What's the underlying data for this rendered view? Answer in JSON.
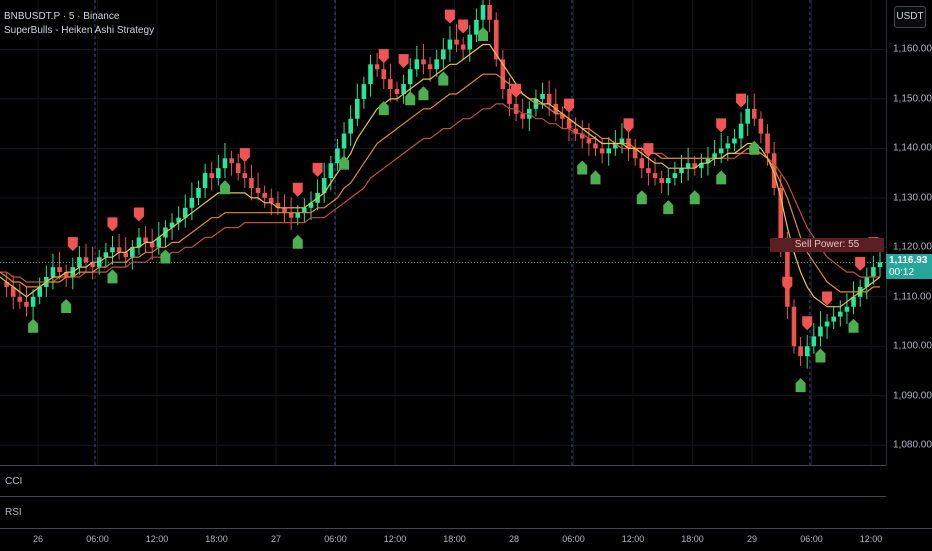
{
  "header": {
    "symbol_line": "BNBUSDT.P · 5 · Binance",
    "strategy_line": "SuperBulls - Heiken Ashi Strategy"
  },
  "currency_button": "USDT",
  "price_axis": {
    "labels": [
      "1,160.00",
      "1,150.00",
      "1,140.00",
      "1,130.00",
      "1,120.00",
      "1,110.00",
      "1,100.00",
      "1,090.00",
      "1,080.00"
    ]
  },
  "current_price": {
    "value": "1,116.93",
    "countdown": "00:12"
  },
  "sell_power_label": "Sell Power: 55",
  "panes": {
    "cci": "CCI",
    "rsi": "RSI"
  },
  "time_axis": {
    "labels": [
      "26",
      "06:00",
      "12:00",
      "18:00",
      "27",
      "06:00",
      "12:00",
      "18:00",
      "28",
      "06:00",
      "12:00",
      "18:00",
      "29",
      "06:00",
      "12:00"
    ]
  },
  "colors": {
    "bull_candle": "#26e69a",
    "bear_candle": "#ef5350",
    "buy_marker": "#4caf50",
    "sell_marker": "#f05454",
    "ma_yellow": "#e8c547",
    "ma_orange": "#e08a2e",
    "ma_red": "#c0503a",
    "session_line": "#3a4aa0"
  },
  "chart_data": {
    "type": "line",
    "title": "BNBUSDT.P · 5 · Binance",
    "ylim": [
      1076,
      1170
    ],
    "close": [
      1113,
      1112,
      1110,
      1109,
      1108,
      1110,
      1112,
      1114,
      1116,
      1115,
      1114,
      1116,
      1118,
      1117,
      1116,
      1118,
      1119,
      1120,
      1119,
      1118,
      1120,
      1122,
      1121,
      1120,
      1122,
      1124,
      1125,
      1126,
      1128,
      1130,
      1132,
      1135,
      1134,
      1136,
      1138,
      1137,
      1135,
      1134,
      1132,
      1131,
      1130,
      1129,
      1128,
      1127,
      1126,
      1127,
      1128,
      1129,
      1131,
      1134,
      1137,
      1140,
      1143,
      1146,
      1150,
      1153,
      1157,
      1156,
      1154,
      1152,
      1151,
      1153,
      1156,
      1158,
      1157,
      1156,
      1158,
      1160,
      1162,
      1161,
      1160,
      1163,
      1166,
      1169,
      1166,
      1158,
      1152,
      1149,
      1147,
      1146,
      1148,
      1150,
      1151,
      1149,
      1147,
      1146,
      1144,
      1143,
      1142,
      1141,
      1140,
      1139,
      1140,
      1141,
      1142,
      1140,
      1138,
      1136,
      1135,
      1134,
      1133,
      1134,
      1135,
      1136,
      1137,
      1136,
      1137,
      1138,
      1139,
      1140,
      1141,
      1142,
      1145,
      1148,
      1146,
      1143,
      1139,
      1132,
      1120,
      1108,
      1100,
      1098,
      1100,
      1102,
      1104,
      1105,
      1106,
      1107,
      1108,
      1110,
      1112,
      1114,
      1116,
      1117
    ],
    "ma_fast": [
      1114,
      1113,
      1112,
      1111,
      1110,
      1111,
      1112,
      1113,
      1114,
      1114,
      1115,
      1115,
      1116,
      1116,
      1117,
      1117,
      1118,
      1118,
      1119,
      1119,
      1120,
      1120,
      1121,
      1121,
      1122,
      1123,
      1124,
      1125,
      1126,
      1127,
      1128,
      1129,
      1130,
      1131,
      1131,
      1131,
      1131,
      1131,
      1130,
      1130,
      1129,
      1129,
      1128,
      1128,
      1128,
      1128,
      1128,
      1129,
      1130,
      1131,
      1133,
      1135,
      1137,
      1139,
      1142,
      1144,
      1146,
      1148,
      1149,
      1150,
      1150,
      1151,
      1152,
      1153,
      1154,
      1154,
      1155,
      1156,
      1157,
      1157,
      1158,
      1159,
      1160,
      1161,
      1161,
      1159,
      1157,
      1155,
      1153,
      1151,
      1150,
      1150,
      1149,
      1149,
      1148,
      1147,
      1146,
      1145,
      1144,
      1143,
      1142,
      1141,
      1141,
      1141,
      1141,
      1140,
      1140,
      1139,
      1138,
      1137,
      1137,
      1136,
      1136,
      1136,
      1136,
      1136,
      1137,
      1137,
      1138,
      1138,
      1139,
      1139,
      1140,
      1141,
      1141,
      1140,
      1138,
      1135,
      1130,
      1124,
      1119,
      1115,
      1112,
      1110,
      1109,
      1108,
      1108,
      1108,
      1109,
      1110,
      1111,
      1112,
      1113,
      1114
    ],
    "ma_mid": [
      1115,
      1114,
      1113,
      1113,
      1112,
      1112,
      1112,
      1113,
      1113,
      1113,
      1114,
      1114,
      1115,
      1115,
      1115,
      1116,
      1116,
      1117,
      1117,
      1117,
      1118,
      1118,
      1119,
      1119,
      1120,
      1120,
      1121,
      1121,
      1122,
      1123,
      1124,
      1125,
      1126,
      1126,
      1127,
      1127,
      1127,
      1127,
      1127,
      1127,
      1127,
      1127,
      1127,
      1127,
      1127,
      1127,
      1127,
      1127,
      1128,
      1128,
      1129,
      1130,
      1132,
      1133,
      1135,
      1137,
      1139,
      1141,
      1142,
      1143,
      1144,
      1145,
      1146,
      1147,
      1148,
      1148,
      1149,
      1150,
      1151,
      1151,
      1152,
      1153,
      1154,
      1155,
      1155,
      1155,
      1154,
      1153,
      1152,
      1151,
      1150,
      1149,
      1149,
      1148,
      1147,
      1147,
      1146,
      1145,
      1144,
      1144,
      1143,
      1142,
      1142,
      1141,
      1141,
      1141,
      1140,
      1140,
      1139,
      1139,
      1138,
      1138,
      1138,
      1138,
      1138,
      1138,
      1138,
      1138,
      1138,
      1138,
      1139,
      1139,
      1139,
      1140,
      1140,
      1139,
      1138,
      1136,
      1133,
      1130,
      1126,
      1122,
      1119,
      1117,
      1115,
      1113,
      1112,
      1111,
      1111,
      1111,
      1111,
      1111,
      1112,
      1112
    ],
    "ma_slow": [
      1115,
      1115,
      1114,
      1114,
      1113,
      1113,
      1113,
      1113,
      1113,
      1114,
      1114,
      1114,
      1114,
      1115,
      1115,
      1115,
      1115,
      1116,
      1116,
      1116,
      1117,
      1117,
      1117,
      1118,
      1118,
      1118,
      1119,
      1119,
      1120,
      1120,
      1121,
      1122,
      1122,
      1123,
      1124,
      1124,
      1124,
      1125,
      1125,
      1125,
      1125,
      1125,
      1125,
      1125,
      1125,
      1125,
      1125,
      1126,
      1126,
      1126,
      1127,
      1128,
      1129,
      1130,
      1131,
      1132,
      1134,
      1135,
      1136,
      1137,
      1138,
      1139,
      1140,
      1141,
      1142,
      1142,
      1143,
      1144,
      1144,
      1145,
      1146,
      1146,
      1147,
      1148,
      1148,
      1149,
      1149,
      1148,
      1148,
      1147,
      1147,
      1146,
      1146,
      1145,
      1145,
      1144,
      1144,
      1143,
      1143,
      1142,
      1142,
      1141,
      1141,
      1141,
      1140,
      1140,
      1140,
      1140,
      1139,
      1139,
      1139,
      1138,
      1138,
      1138,
      1138,
      1138,
      1138,
      1138,
      1138,
      1138,
      1138,
      1138,
      1139,
      1139,
      1139,
      1139,
      1138,
      1137,
      1135,
      1133,
      1130,
      1127,
      1124,
      1122,
      1120,
      1118,
      1117,
      1116,
      1115,
      1115,
      1114,
      1114,
      1114,
      1114
    ],
    "sell_signals": [
      19,
      28,
      36,
      62,
      76,
      81,
      98,
      102,
      115,
      118,
      132,
      144,
      160,
      165,
      184,
      188,
      201,
      205,
      211,
      219,
      222
    ],
    "buy_signals": [
      8,
      17,
      28,
      42,
      58,
      75,
      87,
      98,
      104,
      107,
      113,
      123,
      148,
      152,
      163,
      170,
      177,
      183,
      192,
      204,
      209,
      218
    ]
  }
}
